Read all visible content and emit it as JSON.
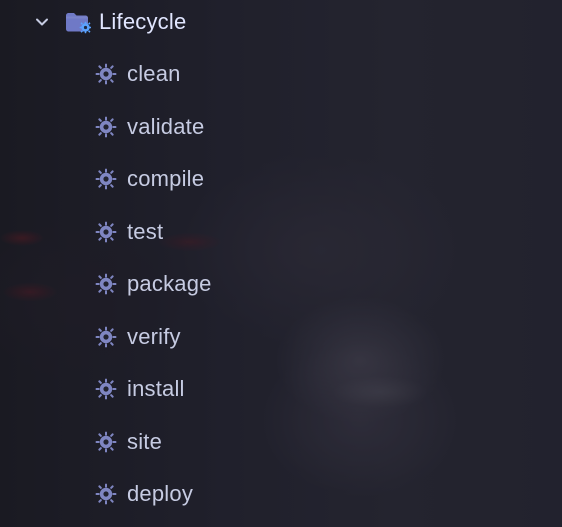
{
  "colors": {
    "text": "#c6cbe2",
    "gear": "#7f86c2",
    "folder": "#6f79c6",
    "folderBadge": "#5aa2ff",
    "chevron": "#c6cbe2"
  },
  "tree": {
    "root": {
      "label": "Lifecycle",
      "expanded_icon": "chevron-down-icon",
      "icon": "folder-gear-icon"
    },
    "items": [
      {
        "label": "clean",
        "icon": "gear-icon"
      },
      {
        "label": "validate",
        "icon": "gear-icon"
      },
      {
        "label": "compile",
        "icon": "gear-icon"
      },
      {
        "label": "test",
        "icon": "gear-icon"
      },
      {
        "label": "package",
        "icon": "gear-icon"
      },
      {
        "label": "verify",
        "icon": "gear-icon"
      },
      {
        "label": "install",
        "icon": "gear-icon"
      },
      {
        "label": "site",
        "icon": "gear-icon"
      },
      {
        "label": "deploy",
        "icon": "gear-icon"
      }
    ]
  }
}
